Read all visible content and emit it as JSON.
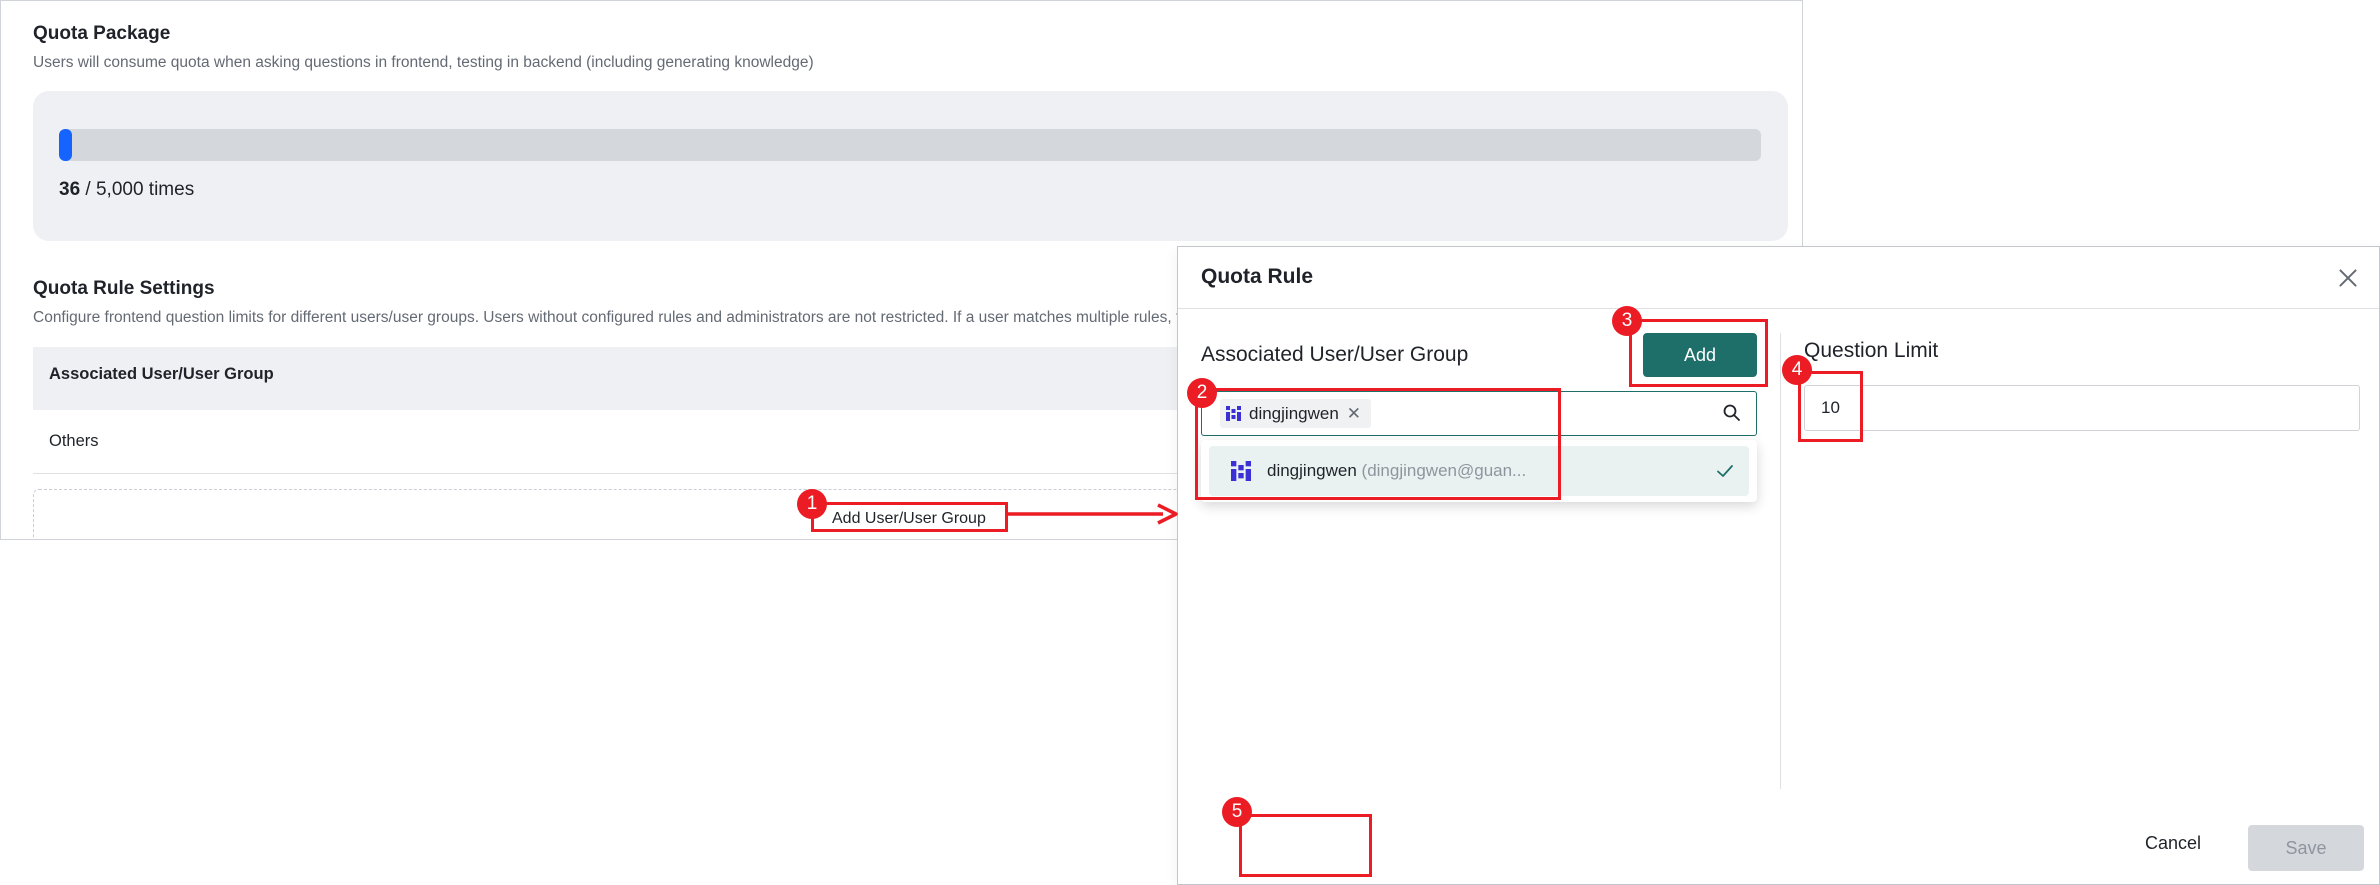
{
  "quota_package": {
    "title": "Quota Package",
    "description": "Users will consume quota when asking questions in frontend, testing in backend (including generating knowledge)",
    "used": "36",
    "separator": " / ",
    "total": "5,000 times",
    "usage_fraction": 0.0072
  },
  "quota_rule_settings": {
    "title": "Quota Rule Settings",
    "description": "Configure frontend question limits for different users/user groups. Users without configured rules and administrators are not restricted. If a user matches multiple rules, the rule with the highest limit takes effect.",
    "table_header": "Associated User/User Group",
    "rows": [
      "Others"
    ],
    "add_label": "Add User/User Group"
  },
  "modal": {
    "title": "Quota Rule",
    "left_title": "Associated User/User Group",
    "add_button": "Add",
    "selected_tag": "dingjingwen",
    "dropdown_name": "dingjingwen",
    "dropdown_email": "(dingjingwen@guan...",
    "right_title": "Question Limit",
    "limit_value": "10",
    "cancel_button": "Cancel",
    "save_button": "Save"
  },
  "annotations": [
    "1",
    "2",
    "3",
    "4",
    "5"
  ],
  "colors": {
    "primary": "#1e6e6a",
    "progress": "#1664ff",
    "highlight": "#ec1c24",
    "avatar": "#3b30d6"
  }
}
